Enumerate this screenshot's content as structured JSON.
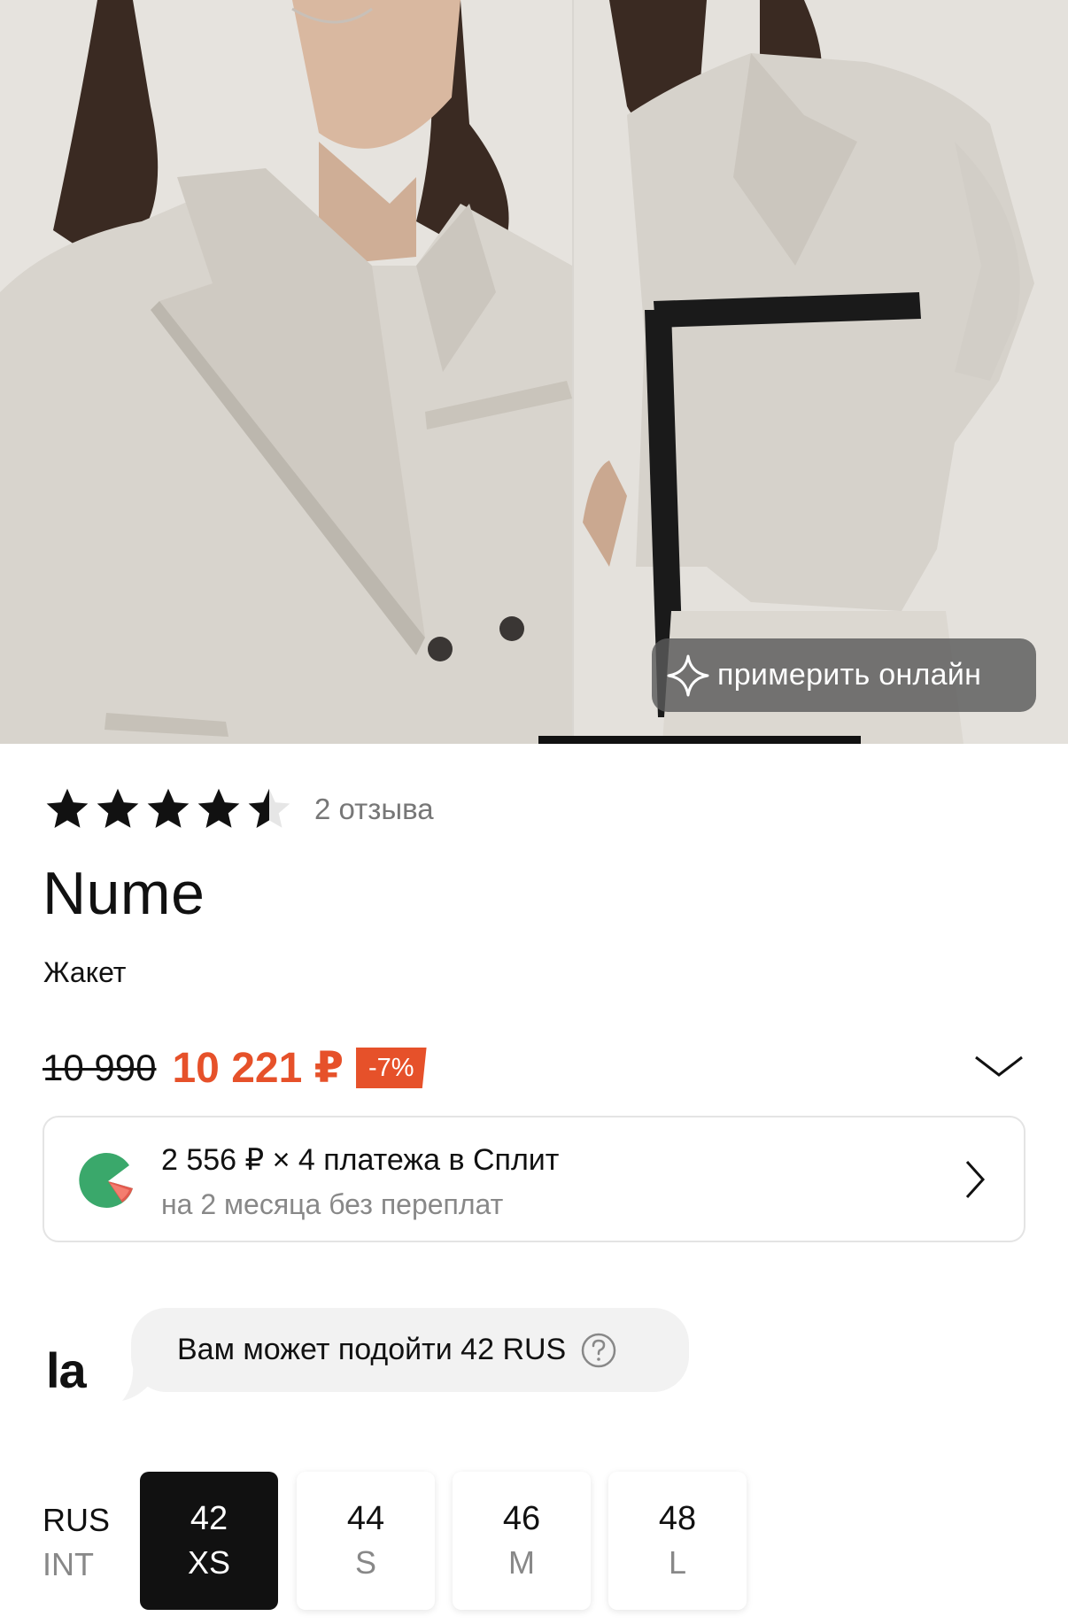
{
  "gallery": {
    "try_on_label": "примерить онлайн",
    "photos": [
      "product-photo-closeup",
      "product-photo-belted"
    ]
  },
  "rating": {
    "value": 4.5,
    "max": 5,
    "reviews": "2 отзыва"
  },
  "product": {
    "brand": "Nume",
    "type": "Жакет"
  },
  "price": {
    "old": "10 990",
    "current": "10 221 ₽",
    "discount": "-7%",
    "accent_color": "#e6512a"
  },
  "split": {
    "title": "2 556 ₽ × 4 платежа в Сплит",
    "subtitle": "на 2 месяца без переплат"
  },
  "size_advisor": {
    "logo": "la",
    "message": "Вам может подойти 42 RUS"
  },
  "sizes": {
    "label_rus": "RUS",
    "label_int": "INT",
    "items": [
      {
        "rus": "42",
        "int": "XS",
        "selected": true
      },
      {
        "rus": "44",
        "int": "S",
        "selected": false
      },
      {
        "rus": "46",
        "int": "M",
        "selected": false
      },
      {
        "rus": "48",
        "int": "L",
        "selected": false
      }
    ]
  }
}
